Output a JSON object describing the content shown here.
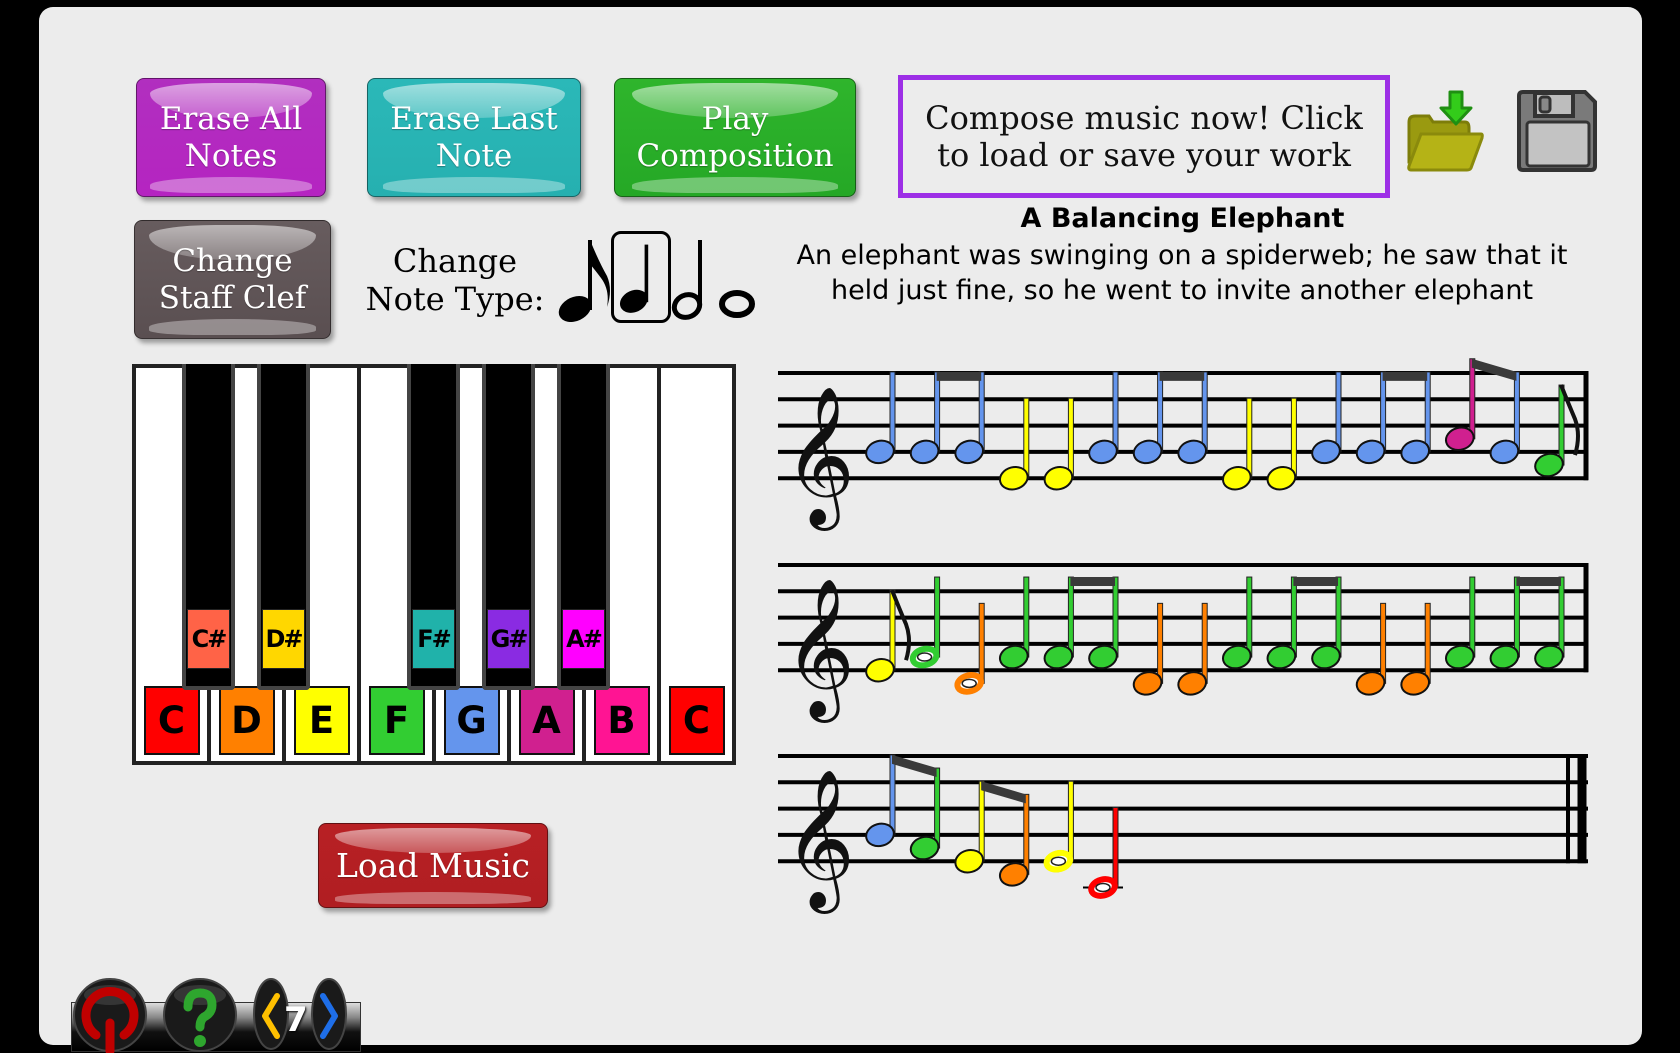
{
  "toolbar_top": {
    "erase_all_label": "Erase All\nNotes",
    "erase_last_label": "Erase Last\nNote",
    "play_label": "Play\nComposition",
    "change_clef_label": "Change\nStaff Clef",
    "load_music_label": "Load Music"
  },
  "compose_prompt": "Compose music now! Click\nto load or save your work",
  "file_icons": {
    "open": "folder-open-icon",
    "save": "floppy-save-icon"
  },
  "note_type": {
    "label": "Change\nNote Type:",
    "options": [
      "eighth",
      "quarter",
      "half",
      "whole"
    ],
    "selected": "quarter"
  },
  "story": {
    "title": "A Balancing Elephant",
    "text": "An elephant was swinging on a spiderweb; he saw that it\nheld just fine, so he went to invite another elephant"
  },
  "piano": {
    "white_keys": [
      {
        "label": "C",
        "color": "#ff0000"
      },
      {
        "label": "D",
        "color": "#ff8000"
      },
      {
        "label": "E",
        "color": "#ffff00"
      },
      {
        "label": "F",
        "color": "#32cd32"
      },
      {
        "label": "G",
        "color": "#6495ed"
      },
      {
        "label": "A",
        "color": "#d0208f"
      },
      {
        "label": "B",
        "color": "#ff1493"
      },
      {
        "label": "C",
        "color": "#ff0000"
      }
    ],
    "black_keys": [
      {
        "label": "C#",
        "color": "#ff6347"
      },
      {
        "label": "D#",
        "color": "#ffd700"
      },
      {
        "label": "F#",
        "color": "#20b2aa"
      },
      {
        "label": "G#",
        "color": "#8a2be2"
      },
      {
        "label": "A#",
        "color": "#ff00ff"
      }
    ]
  },
  "note_colors": {
    "C4": "#ff0000",
    "D4": "#ff8000",
    "E4": "#ffff00",
    "F4": "#32cd32",
    "G4": "#6495ed",
    "A4": "#d0208f",
    "B4": "#ff1493"
  },
  "score": {
    "clef": "treble",
    "staves": [
      [
        {
          "pitch": "G4",
          "dur": "q"
        },
        {
          "pitch": "G4",
          "dur": "8",
          "beam": "start"
        },
        {
          "pitch": "G4",
          "dur": "8",
          "beam": "end"
        },
        {
          "pitch": "E4",
          "dur": "q"
        },
        {
          "pitch": "E4",
          "dur": "q"
        },
        {
          "pitch": "G4",
          "dur": "q"
        },
        {
          "pitch": "G4",
          "dur": "8",
          "beam": "start"
        },
        {
          "pitch": "G4",
          "dur": "8",
          "beam": "end"
        },
        {
          "pitch": "E4",
          "dur": "q"
        },
        {
          "pitch": "E4",
          "dur": "q"
        },
        {
          "pitch": "G4",
          "dur": "q"
        },
        {
          "pitch": "G4",
          "dur": "8",
          "beam": "start"
        },
        {
          "pitch": "G4",
          "dur": "8",
          "beam": "end"
        },
        {
          "pitch": "A4",
          "dur": "8",
          "beam": "start"
        },
        {
          "pitch": "G4",
          "dur": "8",
          "beam": "end"
        },
        {
          "pitch": "F4",
          "dur": "8",
          "flag": true
        }
      ],
      [
        {
          "pitch": "E4",
          "dur": "8",
          "flag": true
        },
        {
          "pitch": "F4",
          "dur": "h"
        },
        {
          "pitch": "D4",
          "dur": "h"
        },
        {
          "pitch": "F4",
          "dur": "q"
        },
        {
          "pitch": "F4",
          "dur": "8",
          "beam": "start"
        },
        {
          "pitch": "F4",
          "dur": "8",
          "beam": "end"
        },
        {
          "pitch": "D4",
          "dur": "q"
        },
        {
          "pitch": "D4",
          "dur": "q"
        },
        {
          "pitch": "F4",
          "dur": "q"
        },
        {
          "pitch": "F4",
          "dur": "8",
          "beam": "start"
        },
        {
          "pitch": "F4",
          "dur": "8",
          "beam": "end"
        },
        {
          "pitch": "D4",
          "dur": "q"
        },
        {
          "pitch": "D4",
          "dur": "q"
        },
        {
          "pitch": "F4",
          "dur": "q"
        },
        {
          "pitch": "F4",
          "dur": "8",
          "beam": "start"
        },
        {
          "pitch": "F4",
          "dur": "8",
          "beam": "end"
        }
      ],
      [
        {
          "pitch": "G4",
          "dur": "8",
          "beam": "start"
        },
        {
          "pitch": "F4",
          "dur": "8",
          "beam": "end"
        },
        {
          "pitch": "E4",
          "dur": "8",
          "beam": "start"
        },
        {
          "pitch": "D4",
          "dur": "8",
          "beam": "end"
        },
        {
          "pitch": "E4",
          "dur": "h"
        },
        {
          "pitch": "C4",
          "dur": "h"
        }
      ]
    ]
  },
  "bottom_bar": {
    "quit_icon": "power-icon",
    "help_icon": "help-question-icon",
    "prev_icon": "chevron-left-icon",
    "next_icon": "chevron-right-icon",
    "page_number": "7"
  }
}
